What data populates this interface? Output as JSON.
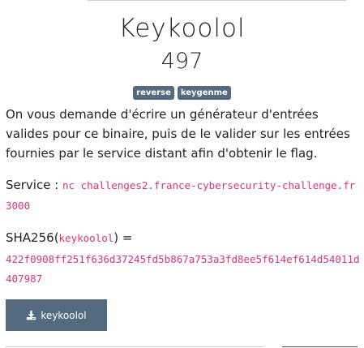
{
  "challenge": {
    "title": "Keykoolol",
    "points": "497",
    "tags": [
      "reverse",
      "keygenme"
    ],
    "description": "On vous demande d'écrire un générateur d'entrées valides pour ce binaire, puis de le valider sur les entrées fournies par le service distant afin d'obtenir le flag.",
    "service_label": "Service : ",
    "service_command": "nc challenges2.france-cybersecurity-challenge.fr 3000",
    "sha_prefix": "SHA256(",
    "sha_filename": "keykoolol",
    "sha_suffix": ") =",
    "sha_value": "422f0908ff251f636d37245fd5b867a753a3fd8ee5f614ef614d54011d407987",
    "download_label": "keykoolol",
    "download_icon": "download-icon",
    "accent_color": "#536a7f",
    "code_color": "#d63384"
  }
}
